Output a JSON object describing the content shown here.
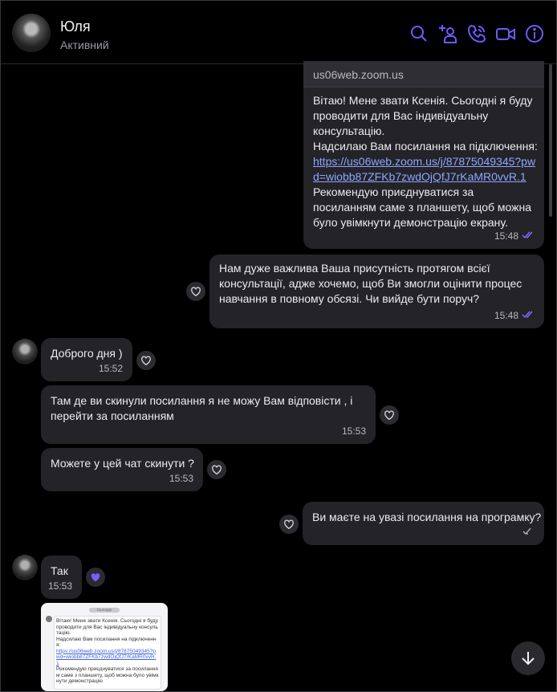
{
  "header": {
    "name": "Юля",
    "status": "Активний",
    "icons": [
      "search-icon",
      "add-participant-icon",
      "phone-icon",
      "video-icon",
      "info-icon"
    ],
    "accent": "#6a5cff"
  },
  "messages": {
    "m1": {
      "preview_domain": "us06web.zoom.us",
      "text_a": "Вітаю! Мене звати Ксенія. Сьогодні я буду проводити для Вас індивідуальну консультацію.",
      "text_b": "Надсилаю Вам посилання на підключення:",
      "link": "https://us06web.zoom.us/j/87875049345?pwd=wiobb87ZFKb7zwdOjQfJ7rKaMR0vvR.1",
      "text_c": "Рекомендую приєднуватися за посиланням саме з планшету, щоб можна було увімкнути демонстрацію екрану.",
      "time": "15:48"
    },
    "m2": {
      "text": "Нам дуже важлива Ваша присутність протягом всієї консультації, адже хочемо, щоб Ви змогли оцінити процес навчання в повному обсязі. Чи вийде бути поруч?",
      "time": "15:48"
    },
    "m3": {
      "text": "Доброго дня )",
      "time": "15:52"
    },
    "m4": {
      "text": "Там де ви скинули посилання я не можу Вам відповісти , і перейти за посиланням",
      "time": "15:53"
    },
    "m5": {
      "text": "Можете у цей чат скинути ?",
      "time": "15:53"
    },
    "m6": {
      "text": "Ви маєте на увазі посилання на програмку?"
    },
    "m7": {
      "text": "Так",
      "time": "15:53"
    },
    "thumb": {
      "tag": "Сьогодні",
      "text_a": "Вітаю! Мене звати Ксенія. Сьогодні я буду проводити для Вас індивідуальну консультацію.",
      "text_b": "Надсилаю Вам посилання на підключення:",
      "link": "https://us06web.zoom.us/j/87875049345?pwd=wiobb87ZFKb7zwdOjQfJ7rKaMR0vvR.1",
      "text_c": "Рекомендую приєднуватися за посиланням саме з планшету, щоб можна було увімкнути демонстрацію"
    }
  },
  "colors": {
    "bubble": "#232328",
    "background": "#000000",
    "link": "#8ea6ff",
    "read_ticks": "#7c6cff",
    "reaction_heart": "#7a5cff"
  }
}
